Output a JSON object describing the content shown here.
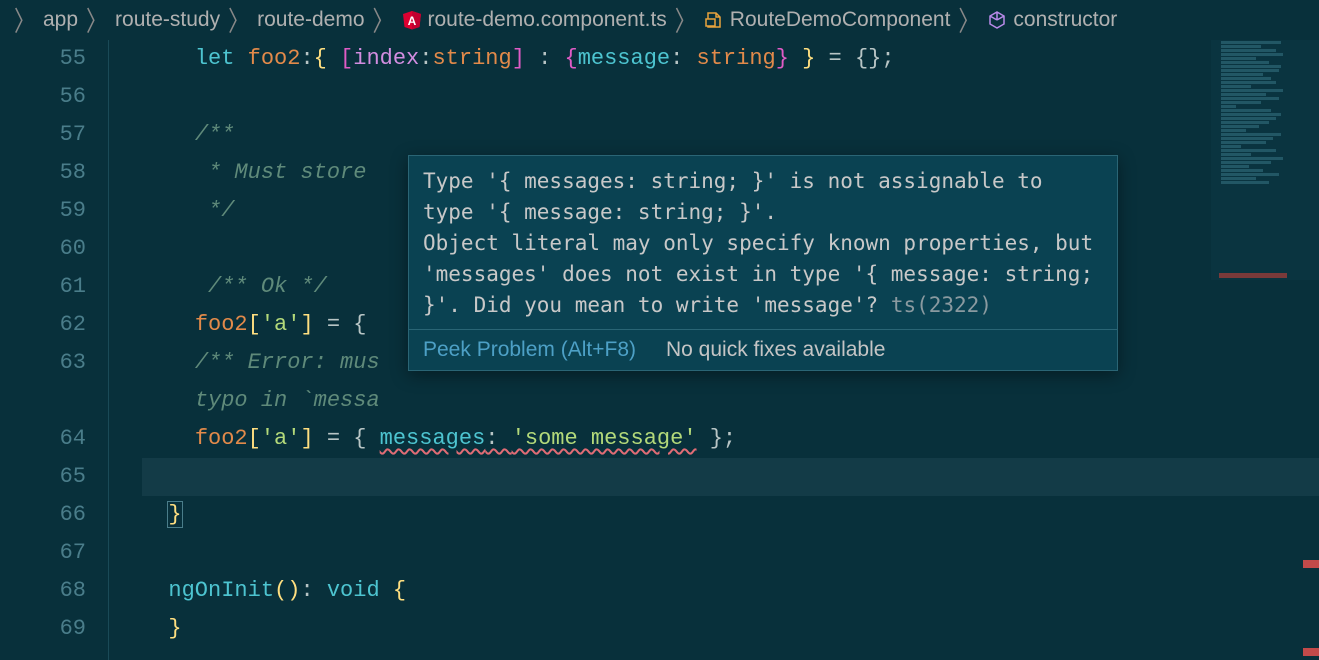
{
  "breadcrumb": [
    {
      "icon": null,
      "label": "app"
    },
    {
      "icon": null,
      "label": "route-study"
    },
    {
      "icon": null,
      "label": "route-demo"
    },
    {
      "icon": "angular",
      "label": "route-demo.component.ts"
    },
    {
      "icon": "class",
      "label": "RouteDemoComponent"
    },
    {
      "icon": "method",
      "label": "constructor"
    }
  ],
  "line_numbers": [
    55,
    56,
    57,
    58,
    59,
    60,
    61,
    62,
    63,
    "",
    64,
    65,
    66,
    67,
    68,
    69
  ],
  "code": {
    "l55": {
      "let": "let",
      "foo2": "foo2",
      "idx": "index",
      "str": "string",
      "msg": "message",
      "str2": "string",
      "eq": " = {};"
    },
    "l57": "/**",
    "l58": " * Must store stuff that conforms to the structure",
    "l58_visible": " * Must store ",
    "l59": " */",
    "l61": "/** Ok */",
    "l62": {
      "foo2": "foo2",
      "key": "'a'",
      "eq": " = { "
    },
    "l63a": "/** Error: mus",
    "l63b": "typo in `messa",
    "l64": {
      "foo2": "foo2",
      "key": "'a'",
      "eq": " = { ",
      "prop": "messages",
      "colon": ": ",
      "val": "'some message'",
      "end": " };"
    },
    "l66": "}",
    "l68": {
      "fn": "ngOnInit",
      "p": "()",
      "c": ": ",
      "void": "void",
      "b": " {"
    },
    "l69": "}"
  },
  "hover": {
    "msg_line1": "Type '{ messages: string; }' is not assignable to type '{ message: string; }'.",
    "msg_line2": "  Object literal may only specify known properties, but 'messages' does not exist in type '{ message: string; }'. Did you mean to write 'message'?",
    "code": "ts(2322)",
    "peek_label": "Peek Problem (Alt+F8)",
    "noquick_label": "No quick fixes available"
  }
}
